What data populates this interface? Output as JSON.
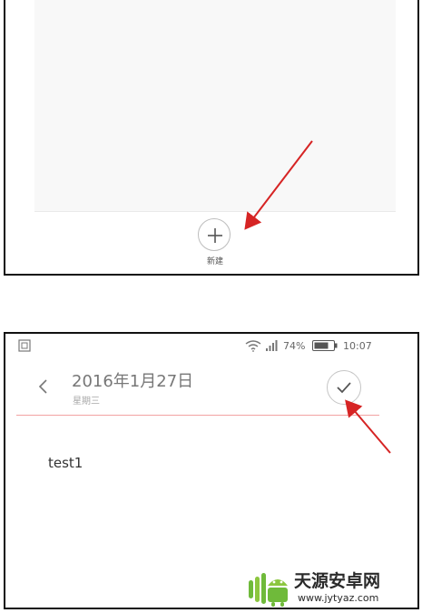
{
  "panel_top": {
    "new_button": {
      "label": "新建",
      "icon": "plus-icon"
    }
  },
  "panel_bottom": {
    "status_bar": {
      "left_icon": "screenshot-icon",
      "wifi_icon": "wifi-icon",
      "signal_icon": "signal-icon",
      "battery_percent": "74%",
      "battery_icon": "battery-icon",
      "time": "10:07"
    },
    "header": {
      "back_icon": "chevron-left-icon",
      "date": "2016年1月27日",
      "weekday": "星期三",
      "confirm_icon": "check-icon"
    },
    "note": {
      "body": "test1"
    }
  },
  "annotations": {
    "arrow_color": "#d62424"
  },
  "colors": {
    "divider_accent": "#f2a3a3",
    "content_background": "#f8f8f8"
  },
  "watermark": {
    "title": "天源安卓网",
    "url": "www.jytyaz.com",
    "logo_icon": "android-logo-icon"
  }
}
